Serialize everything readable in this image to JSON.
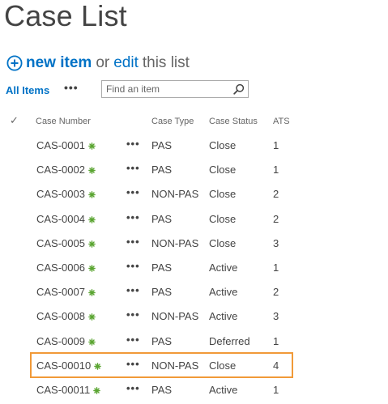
{
  "page": {
    "title": "Case List"
  },
  "actions": {
    "new_item_label": "new item",
    "or_text": "or",
    "edit_label": "edit",
    "this_list_text": "this list",
    "accent_color": "#0072c6"
  },
  "view": {
    "current_view": "All Items",
    "more_label": "•••",
    "search_placeholder": "Find an item"
  },
  "list": {
    "columns": [
      "Case Number",
      "Case Type",
      "Case Status",
      "ATS"
    ],
    "row_menu_label": "•••",
    "new_badge_icon": "new-item-asterisk-icon",
    "highlighted_row": "CAS-00010",
    "highlight_color": "#f19a38",
    "rows": [
      {
        "case_number": "CAS-0001",
        "case_type": "PAS",
        "case_status": "Close",
        "ats": "1"
      },
      {
        "case_number": "CAS-0002",
        "case_type": "PAS",
        "case_status": "Close",
        "ats": "1"
      },
      {
        "case_number": "CAS-0003",
        "case_type": "NON-PAS",
        "case_status": "Close",
        "ats": "2"
      },
      {
        "case_number": "CAS-0004",
        "case_type": "PAS",
        "case_status": "Close",
        "ats": "2"
      },
      {
        "case_number": "CAS-0005",
        "case_type": "NON-PAS",
        "case_status": "Close",
        "ats": "3"
      },
      {
        "case_number": "CAS-0006",
        "case_type": "PAS",
        "case_status": "Active",
        "ats": "1"
      },
      {
        "case_number": "CAS-0007",
        "case_type": "PAS",
        "case_status": "Active",
        "ats": "2"
      },
      {
        "case_number": "CAS-0008",
        "case_type": "NON-PAS",
        "case_status": "Active",
        "ats": "3"
      },
      {
        "case_number": "CAS-0009",
        "case_type": "PAS",
        "case_status": "Deferred",
        "ats": "1"
      },
      {
        "case_number": "CAS-00010",
        "case_type": "NON-PAS",
        "case_status": "Close",
        "ats": "4"
      },
      {
        "case_number": "CAS-00011",
        "case_type": "PAS",
        "case_status": "Active",
        "ats": "1"
      }
    ]
  }
}
